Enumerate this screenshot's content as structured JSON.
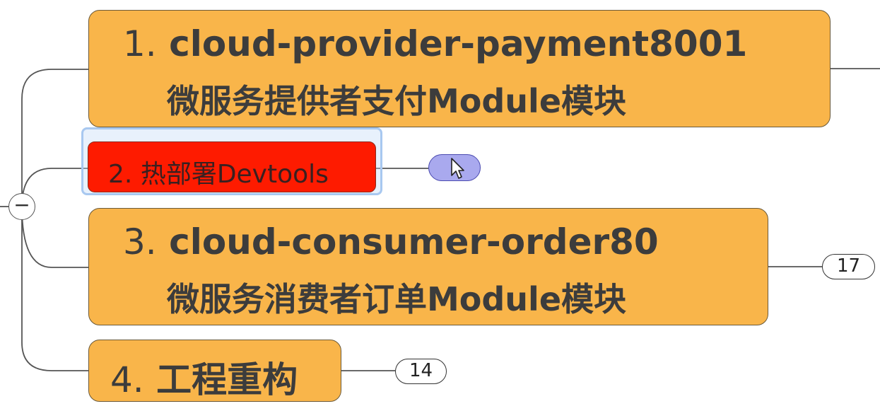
{
  "nodes": [
    {
      "number": "1.",
      "title": "cloud-provider-payment8001",
      "subtitle": "微服务提供者支付Module模块"
    },
    {
      "number": "2.",
      "title": "热部署Devtools",
      "selected": true,
      "color": "#fe1b00"
    },
    {
      "number": "3.",
      "title": "cloud-consumer-order80",
      "subtitle": "微服务消费者订单Module模块",
      "collapsed_count": "17"
    },
    {
      "number": "4.",
      "title": "工程重构",
      "collapsed_count": "14"
    }
  ],
  "collapse_toggle": "−",
  "colors": {
    "topic_fill": "#f9b54a",
    "selected_fill": "#fe1b00",
    "connector": "#555555",
    "note_pill": "#a9a9ee"
  },
  "icons": {
    "cursor": "mouse-pointer-icon",
    "collapse": "minus-icon"
  }
}
